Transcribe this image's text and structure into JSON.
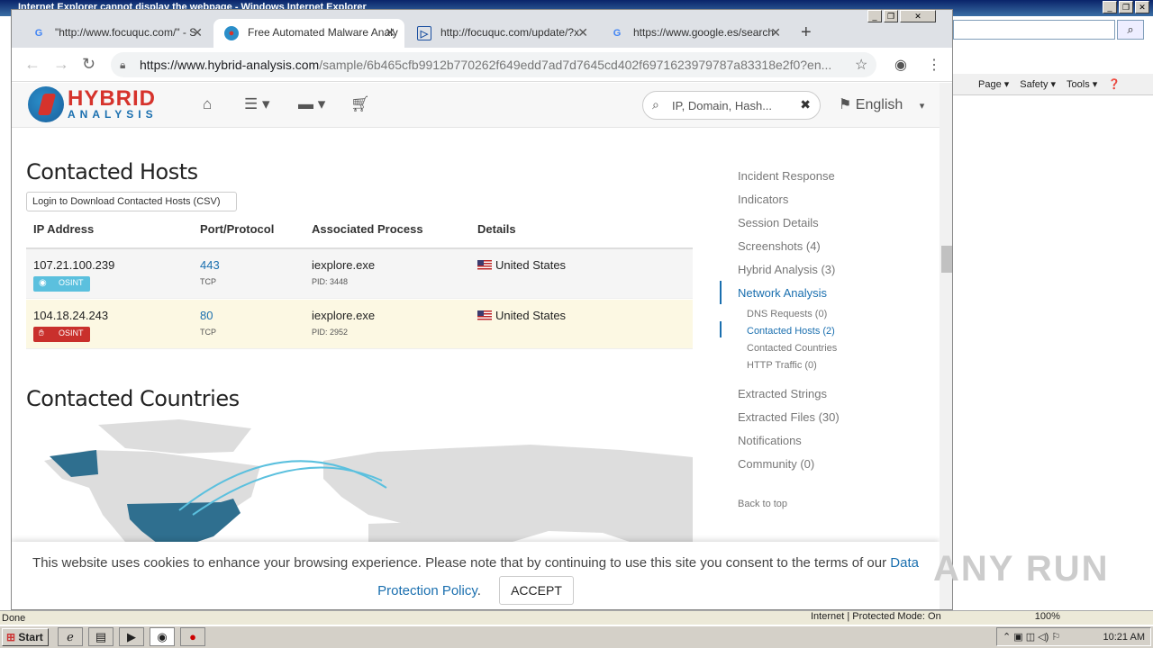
{
  "ie": {
    "title": "Internet Explorer cannot display the webpage - Windows Internet Explorer",
    "cmd": [
      "Page ▾",
      "Safety ▾",
      "Tools ▾"
    ],
    "status_left": "Done",
    "status_zone": "Internet | Protected Mode: On",
    "zoom": "100%"
  },
  "taskbar": {
    "start": "Start",
    "clock": "10:21 AM"
  },
  "tabs": [
    {
      "label": "\"http://www.focuquc.com/\" - S",
      "icon": "google-icon"
    },
    {
      "label": "Free Automated Malware Analy",
      "icon": "hybrid-analysis-icon"
    },
    {
      "label": "http://focuquc.com/update/?x",
      "icon": "doc-icon"
    },
    {
      "label": "https://www.google.es/search",
      "icon": "google-icon"
    }
  ],
  "omnibox": {
    "host": "https://www.hybrid-analysis.com",
    "path": "/sample/6b465cfb9912b770262f649edd7ad7d7645cd402f6971623979787a83318e2f0?en..."
  },
  "site": {
    "logo_top": "HYBRID",
    "logo_bottom": "ANALYSIS",
    "search_placeholder": "IP, Domain, Hash...",
    "language": "English"
  },
  "contacted_hosts": {
    "title": "Contacted Hosts",
    "csv_button": "Login to Download Contacted Hosts (CSV)",
    "columns": [
      "IP Address",
      "Port/Protocol",
      "Associated Process",
      "Details"
    ],
    "rows": [
      {
        "ip": "107.21.100.239",
        "port": "443",
        "proto": "TCP",
        "process": "iexplore.exe",
        "pid": "PID: 3448",
        "country": "United States",
        "osint": "OSINT",
        "osint_color": "#5bc0de"
      },
      {
        "ip": "104.18.24.243",
        "port": "80",
        "proto": "TCP",
        "process": "iexplore.exe",
        "pid": "PID: 2952",
        "country": "United States",
        "osint": "OSINT",
        "osint_color": "#c9302c"
      }
    ]
  },
  "contacted_countries": {
    "title": "Contacted Countries"
  },
  "right_nav": {
    "items": [
      "Incident Response",
      "Indicators",
      "Session Details",
      "Screenshots (4)",
      "Hybrid Analysis (3)",
      "Network Analysis"
    ],
    "sub": [
      "DNS Requests (0)",
      "Contacted Hosts (2)",
      "Contacted Countries",
      "HTTP Traffic (0)"
    ],
    "items2": [
      "Extracted Strings",
      "Extracted Files (30)",
      "Notifications",
      "Community (0)"
    ],
    "back": "Back to top"
  },
  "cookie": {
    "text": "This website uses cookies to enhance your browsing experience. Please note that by continuing to use this site you consent to the terms of our",
    "link": "Data Protection Policy",
    "accept": "ACCEPT"
  },
  "watermark": "ANY RUN",
  "colors": {
    "accent": "#1a6faf",
    "highlight_row": "#fcf8e3",
    "us_map": "#2f6f8f"
  }
}
